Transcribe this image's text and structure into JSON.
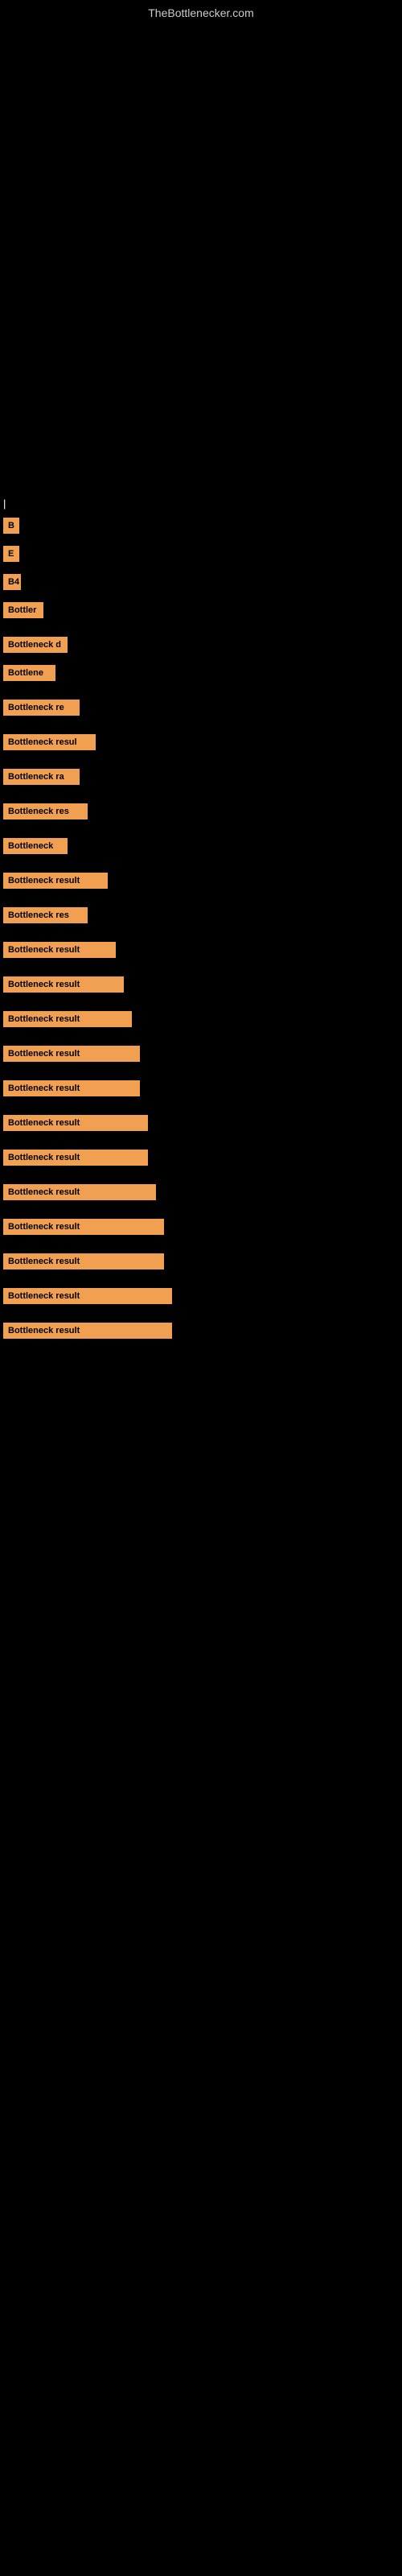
{
  "site": {
    "title": "TheBottlenecker.com"
  },
  "bars": [
    {
      "id": 1,
      "label": "B",
      "width_class": "bar-w-20",
      "margin": "result-row"
    },
    {
      "id": 2,
      "label": "E",
      "width_class": "bar-w-20",
      "margin": "result-row"
    },
    {
      "id": 3,
      "label": "B4",
      "width_class": "bar-w-22",
      "margin": "result-row"
    },
    {
      "id": 4,
      "label": "Bottler",
      "width_class": "bar-w-50",
      "margin": "result-row"
    },
    {
      "id": 5,
      "label": "Bottleneck d",
      "width_class": "bar-w-80",
      "margin": "result-row-large"
    },
    {
      "id": 6,
      "label": "Bottlene",
      "width_class": "bar-w-65",
      "margin": "result-row"
    },
    {
      "id": 7,
      "label": "Bottleneck re",
      "width_class": "bar-w-95",
      "margin": "result-row-large"
    },
    {
      "id": 8,
      "label": "Bottleneck resul",
      "width_class": "bar-w-115",
      "margin": "result-row-large"
    },
    {
      "id": 9,
      "label": "Bottleneck ra",
      "width_class": "bar-w-95",
      "margin": "result-row-large"
    },
    {
      "id": 10,
      "label": "Bottleneck res",
      "width_class": "bar-w-105",
      "margin": "result-row-large"
    },
    {
      "id": 11,
      "label": "Bottleneck",
      "width_class": "bar-w-80",
      "margin": "result-row-large"
    },
    {
      "id": 12,
      "label": "Bottleneck result",
      "width_class": "bar-w-130",
      "margin": "result-row-large"
    },
    {
      "id": 13,
      "label": "Bottleneck res",
      "width_class": "bar-w-105",
      "margin": "result-row-large"
    },
    {
      "id": 14,
      "label": "Bottleneck result",
      "width_class": "bar-w-140",
      "margin": "result-row-large"
    },
    {
      "id": 15,
      "label": "Bottleneck result",
      "width_class": "bar-w-150",
      "margin": "result-row-large"
    },
    {
      "id": 16,
      "label": "Bottleneck result",
      "width_class": "bar-w-160",
      "margin": "result-row-large"
    },
    {
      "id": 17,
      "label": "Bottleneck result",
      "width_class": "bar-w-170",
      "margin": "result-row-large"
    },
    {
      "id": 18,
      "label": "Bottleneck result",
      "width_class": "bar-w-170",
      "margin": "result-row-large"
    },
    {
      "id": 19,
      "label": "Bottleneck result",
      "width_class": "bar-w-180",
      "margin": "result-row-large"
    },
    {
      "id": 20,
      "label": "Bottleneck result",
      "width_class": "bar-w-180",
      "margin": "result-row-large"
    },
    {
      "id": 21,
      "label": "Bottleneck result",
      "width_class": "bar-w-190",
      "margin": "result-row-large"
    },
    {
      "id": 22,
      "label": "Bottleneck result",
      "width_class": "bar-w-200",
      "margin": "result-row-large"
    },
    {
      "id": 23,
      "label": "Bottleneck result",
      "width_class": "bar-w-200",
      "margin": "result-row-large"
    },
    {
      "id": 24,
      "label": "Bottleneck result",
      "width_class": "bar-w-210",
      "margin": "result-row-large"
    },
    {
      "id": 25,
      "label": "Bottleneck result",
      "width_class": "bar-w-210",
      "margin": "result-row-large"
    }
  ],
  "section_label": "|"
}
